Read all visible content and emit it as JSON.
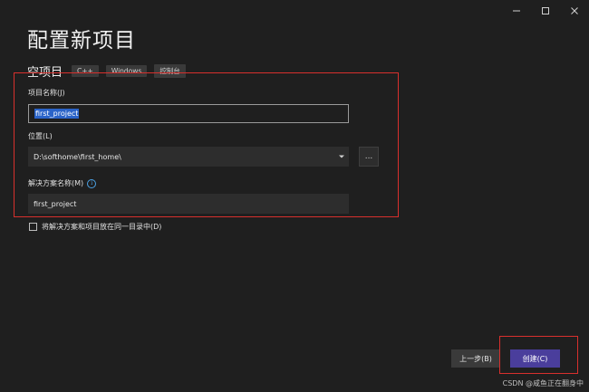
{
  "window": {
    "title": "配置新项目",
    "controls": {
      "minimize": "—",
      "maximize": "☐",
      "close": "✕"
    }
  },
  "template": {
    "name": "空项目",
    "tags": [
      "C++",
      "Windows",
      "控制台"
    ]
  },
  "form": {
    "project_name_label": "项目名称(J)",
    "project_name_value": "first_project",
    "location_label": "位置(L)",
    "location_value": "D:\\softhome\\first_home\\",
    "browse_label": "...",
    "solution_name_label": "解决方案名称(M)",
    "solution_name_value": "first_project",
    "info_icon": "i",
    "same_dir_checkbox_label": "将解决方案和项目放在同一目录中(D)",
    "same_dir_checked": false
  },
  "footer": {
    "back_label": "上一步(B)",
    "create_label": "创建(C)"
  },
  "watermark": "CSDN @咸鱼正在翻身中",
  "colors": {
    "background": "#1f1f1f",
    "accent": "#4a3e9c",
    "highlight_red": "#d8302d",
    "selection": "#2a63c8"
  }
}
